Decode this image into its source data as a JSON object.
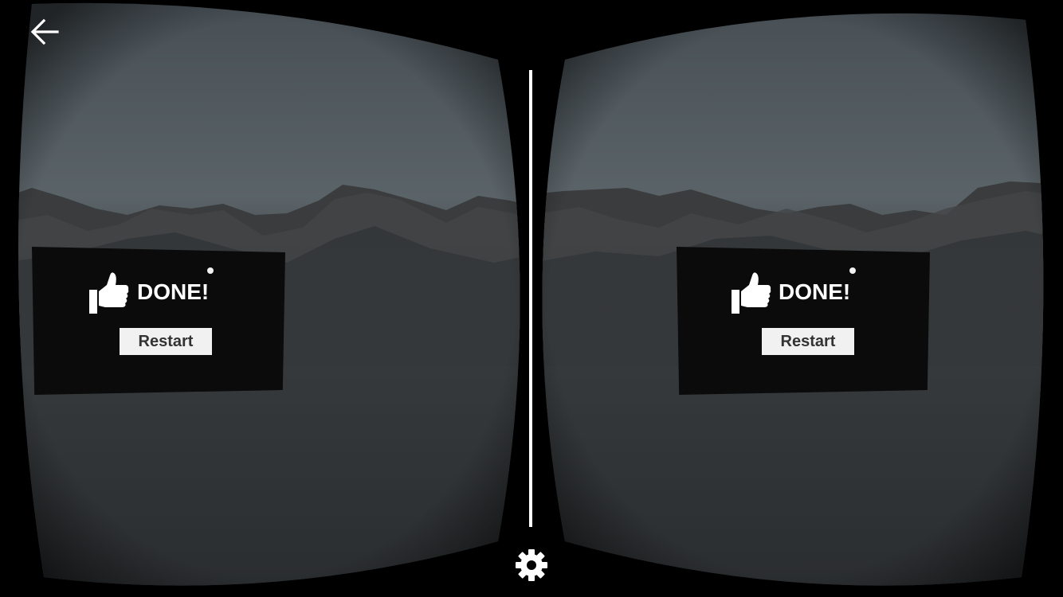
{
  "app": {
    "mode": "VR stereo (split-screen)",
    "background_color": "#000000",
    "divider_color": "#ffffff"
  },
  "toolbar": {
    "back_icon": "arrow-left-icon",
    "settings_icon": "gear-icon"
  },
  "scene": {
    "sky_color_top": "#505a60",
    "sky_color_horizon": "#5c666b",
    "mountain_color": "#3b3d3e",
    "fog_color": "#2f3234"
  },
  "left_eye": {
    "panel": {
      "icon": "thumbs-up-icon",
      "title": "DONE!",
      "button_label": "Restart"
    }
  },
  "right_eye": {
    "panel": {
      "icon": "thumbs-up-icon",
      "title": "DONE!",
      "button_label": "Restart"
    }
  }
}
